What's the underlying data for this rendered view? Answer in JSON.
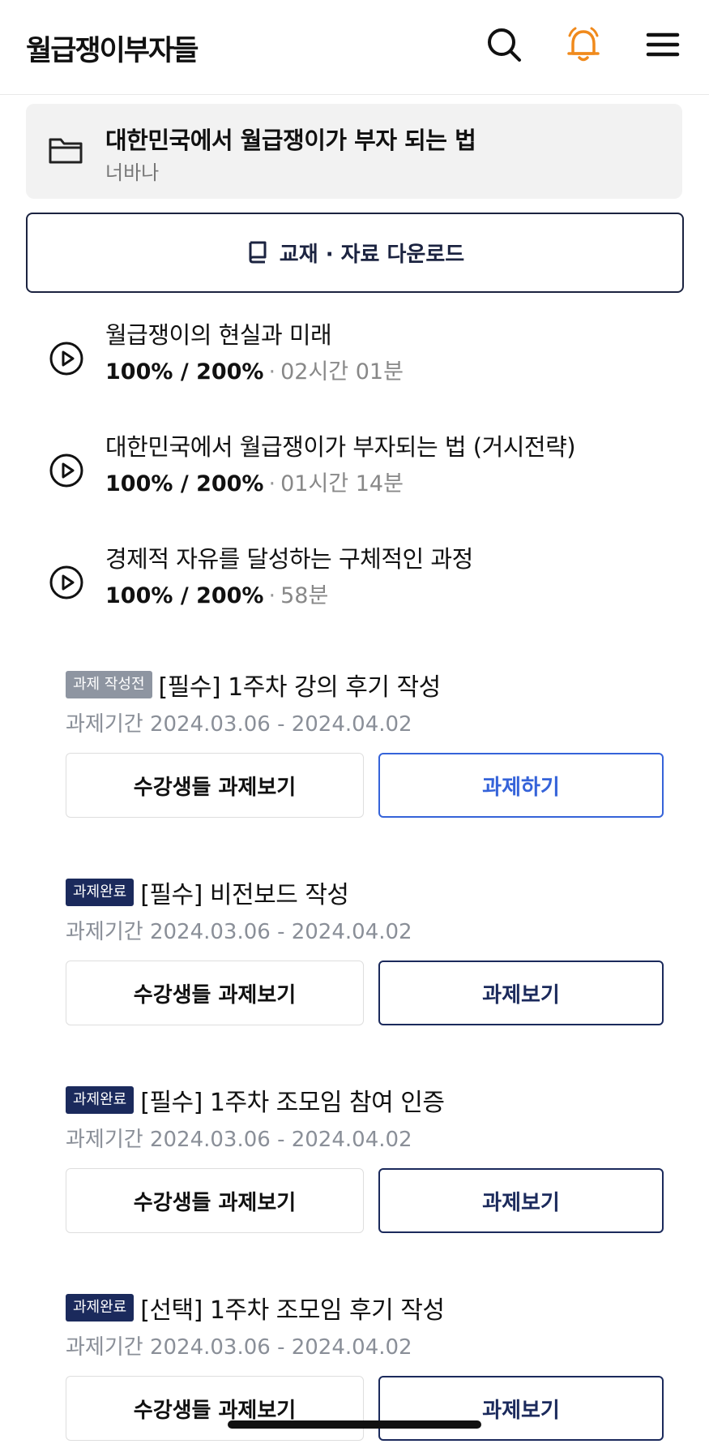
{
  "header": {
    "brand": "월급쟁이부자들",
    "icons": {
      "search": "search-icon",
      "bell": "bell-icon",
      "menu": "hamburger-menu-icon"
    },
    "colors": {
      "bell": "#f08a1c"
    }
  },
  "course": {
    "title": "대한민국에서 월급쟁이가 부자 되는 법",
    "author": "너바나",
    "icon": "folder-icon"
  },
  "download": {
    "label": "교재 · 자료 다운로드",
    "icon": "book-icon"
  },
  "lectures": [
    {
      "title": "월급쟁이의 현실과 미래",
      "progress": "100% / 200%",
      "separator": "·",
      "duration": "02시간 01분"
    },
    {
      "title": "대한민국에서 월급쟁이가 부자되는 법 (거시전략)",
      "progress": "100% / 200%",
      "separator": "·",
      "duration": "01시간 14분"
    },
    {
      "title": "경제적 자유를 달성하는 구체적인 과정",
      "progress": "100% / 200%",
      "separator": "·",
      "duration": "58분"
    }
  ],
  "assignments": [
    {
      "badge": "과제 작성전",
      "badge_color": "#8e95a1",
      "title": "[필수] 1주차 강의 후기 작성",
      "period": "과제기간 2024.03.06 - 2024.04.02",
      "peer_button": "수강생들 과제보기",
      "action_button": "과제하기"
    },
    {
      "badge": "과제완료",
      "badge_color": "#1b2a5c",
      "title": "[필수] 비전보드 작성",
      "period": "과제기간 2024.03.06 - 2024.04.02",
      "peer_button": "수강생들 과제보기",
      "action_button": "과제보기"
    },
    {
      "badge": "과제완료",
      "badge_color": "#1b2a5c",
      "title": "[필수] 1주차 조모임 참여 인증",
      "period": "과제기간 2024.03.06 - 2024.04.02",
      "peer_button": "수강생들 과제보기",
      "action_button": "과제보기"
    },
    {
      "badge": "과제완료",
      "badge_color": "#1b2a5c",
      "title": "[선택] 1주차 조모임 후기 작성",
      "period": "과제기간 2024.03.06 - 2024.04.02",
      "peer_button": "수강생들 과제보기",
      "action_button": "과제보기"
    }
  ]
}
